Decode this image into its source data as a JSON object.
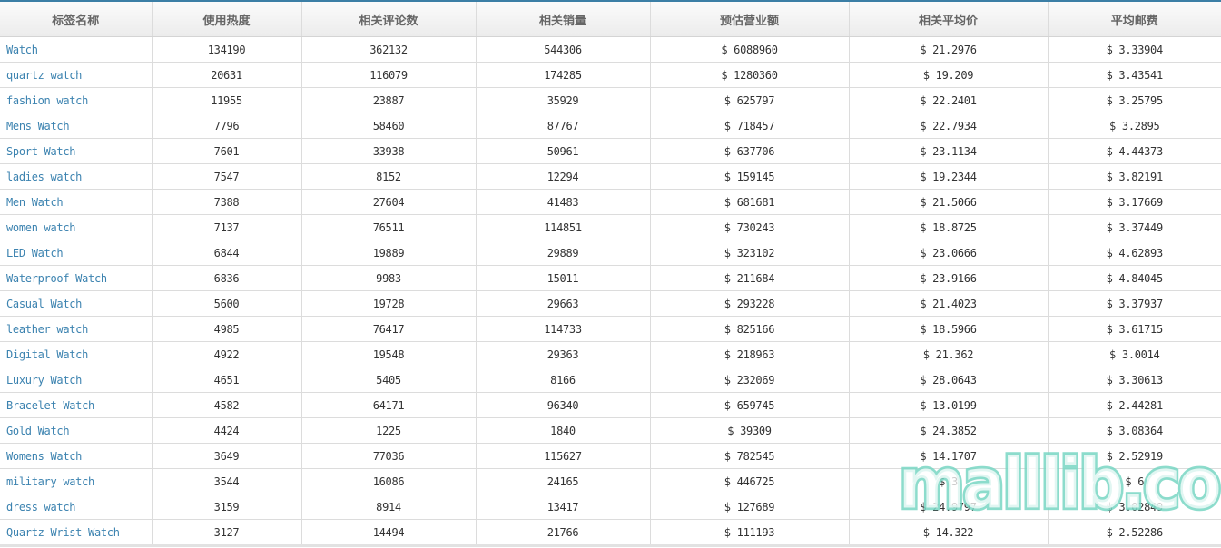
{
  "table": {
    "headers": [
      "标签名称",
      "使用热度",
      "相关评论数",
      "相关销量",
      "预估营业额",
      "相关平均价",
      "平均邮费"
    ],
    "rows": [
      [
        "Watch",
        "134190",
        "362132",
        "544306",
        "$ 6088960",
        "$ 21.2976",
        "$ 3.33904"
      ],
      [
        "quartz watch",
        "20631",
        "116079",
        "174285",
        "$ 1280360",
        "$ 19.209",
        "$ 3.43541"
      ],
      [
        "fashion watch",
        "11955",
        "23887",
        "35929",
        "$ 625797",
        "$ 22.2401",
        "$ 3.25795"
      ],
      [
        "Mens Watch",
        "7796",
        "58460",
        "87767",
        "$ 718457",
        "$ 22.7934",
        "$ 3.2895"
      ],
      [
        "Sport Watch",
        "7601",
        "33938",
        "50961",
        "$ 637706",
        "$ 23.1134",
        "$ 4.44373"
      ],
      [
        "ladies watch",
        "7547",
        "8152",
        "12294",
        "$ 159145",
        "$ 19.2344",
        "$ 3.82191"
      ],
      [
        "Men Watch",
        "7388",
        "27604",
        "41483",
        "$ 681681",
        "$ 21.5066",
        "$ 3.17669"
      ],
      [
        "women watch",
        "7137",
        "76511",
        "114851",
        "$ 730243",
        "$ 18.8725",
        "$ 3.37449"
      ],
      [
        "LED Watch",
        "6844",
        "19889",
        "29889",
        "$ 323102",
        "$ 23.0666",
        "$ 4.62893"
      ],
      [
        "Waterproof Watch",
        "6836",
        "9983",
        "15011",
        "$ 211684",
        "$ 23.9166",
        "$ 4.84045"
      ],
      [
        "Casual Watch",
        "5600",
        "19728",
        "29663",
        "$ 293228",
        "$ 21.4023",
        "$ 3.37937"
      ],
      [
        "leather watch",
        "4985",
        "76417",
        "114733",
        "$ 825166",
        "$ 18.5966",
        "$ 3.61715"
      ],
      [
        "Digital Watch",
        "4922",
        "19548",
        "29363",
        "$ 218963",
        "$ 21.362",
        "$ 3.0014"
      ],
      [
        "Luxury Watch",
        "4651",
        "5405",
        "8166",
        "$ 232069",
        "$ 28.0643",
        "$ 3.30613"
      ],
      [
        "Bracelet Watch",
        "4582",
        "64171",
        "96340",
        "$ 659745",
        "$ 13.0199",
        "$ 2.44281"
      ],
      [
        "Gold Watch",
        "4424",
        "1225",
        "1840",
        "$ 39309",
        "$ 24.3852",
        "$ 3.08364"
      ],
      [
        "Womens Watch",
        "3649",
        "77036",
        "115627",
        "$ 782545",
        "$ 14.1707",
        "$ 2.52919"
      ],
      [
        "military watch",
        "3544",
        "16086",
        "24165",
        "$ 446725",
        "$  3  ",
        "$   6  "
      ],
      [
        "dress watch",
        "3159",
        "8914",
        "13417",
        "$ 127689",
        "$ 24.9797",
        "$ 3.02849"
      ],
      [
        "Quartz Wrist Watch",
        "3127",
        "14494",
        "21766",
        "$ 111193",
        "$ 14.322",
        "$ 2.52286"
      ]
    ]
  },
  "watermark": {
    "text": "malllib.com"
  },
  "colors": {
    "link": "#3c83b0",
    "header_border": "#3c7fa6",
    "watermark": "#78d6c3"
  }
}
